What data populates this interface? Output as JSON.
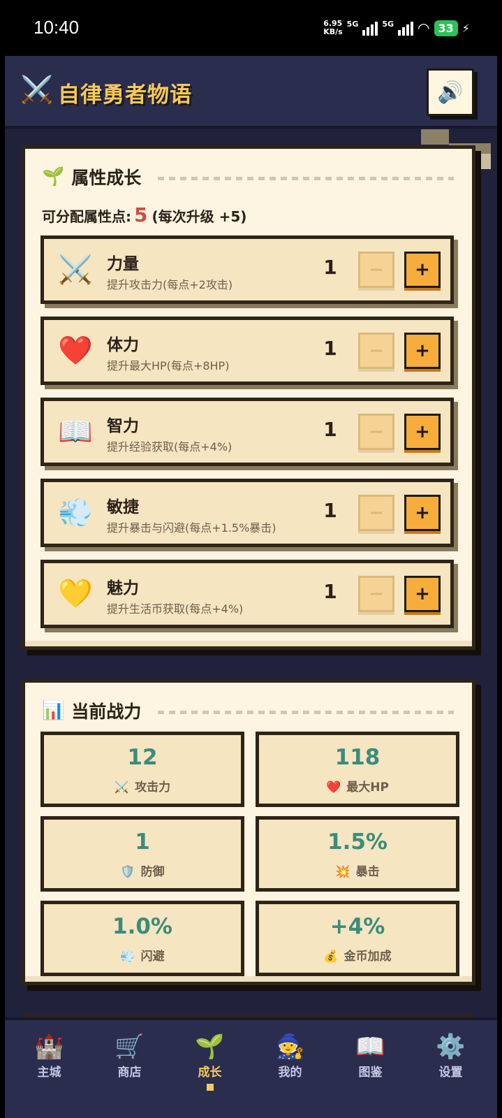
{
  "status_bar": {
    "time": "10:40",
    "net_speed_value": "6.95",
    "net_speed_unit": "KB/s",
    "signal1": "5G",
    "signal2": "5G",
    "battery": "33"
  },
  "header": {
    "icon": "crossed-swords-icon",
    "title": "自律勇者物语",
    "sound_icon": "speaker-icon"
  },
  "growth_panel": {
    "icon": "sprout-icon",
    "title": "属性成长",
    "points_label": "可分配属性点:",
    "points_value": "5",
    "points_note": "(每次升级 +5)",
    "attributes": [
      {
        "icon": "⚔️",
        "name": "力量",
        "desc": "提升攻击力(每点+2攻击)",
        "value": "1",
        "minus": "−",
        "plus": "+"
      },
      {
        "icon": "❤️",
        "name": "体力",
        "desc": "提升最大HP(每点+8HP)",
        "value": "1",
        "minus": "−",
        "plus": "+"
      },
      {
        "icon": "📖",
        "name": "智力",
        "desc": "提升经验获取(每点+4%)",
        "value": "1",
        "minus": "−",
        "plus": "+"
      },
      {
        "icon": "💨",
        "name": "敏捷",
        "desc": "提升暴击与闪避(每点+1.5%暴击)",
        "value": "1",
        "minus": "−",
        "plus": "+"
      },
      {
        "icon": "💛",
        "name": "魅力",
        "desc": "提升生活币获取(每点+4%)",
        "value": "1",
        "minus": "−",
        "plus": "+"
      }
    ]
  },
  "power_panel": {
    "icon": "bar-chart-icon",
    "title": "当前战力",
    "stats": [
      {
        "value": "12",
        "icon": "⚔️",
        "label": "攻击力"
      },
      {
        "value": "118",
        "icon": "❤️",
        "label": "最大HP"
      },
      {
        "value": "1",
        "icon": "🛡️",
        "label": "防御"
      },
      {
        "value": "1.5%",
        "icon": "💥",
        "label": "暴击"
      },
      {
        "value": "1.0%",
        "icon": "💨",
        "label": "闪避"
      },
      {
        "value": "+4%",
        "icon": "💰",
        "label": "金币加成"
      }
    ]
  },
  "nav": {
    "items": [
      {
        "icon": "🏰",
        "label": "主城"
      },
      {
        "icon": "🛒",
        "label": "商店"
      },
      {
        "icon": "🌱",
        "label": "成长"
      },
      {
        "icon": "🧙",
        "label": "我的"
      },
      {
        "icon": "📖",
        "label": "图鉴"
      },
      {
        "icon": "⚙️",
        "label": "设置"
      }
    ],
    "active_label": "成长"
  },
  "colors": {
    "accent": "#f7c95a",
    "stat_value": "#3a8d7c",
    "points_value": "#c9503f",
    "plus_button": "#f6ad3c"
  }
}
